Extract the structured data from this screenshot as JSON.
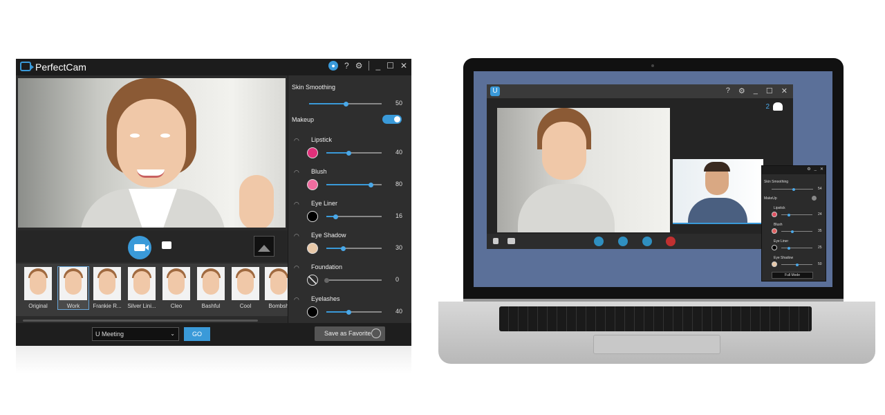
{
  "app": {
    "title": "PerfectCam",
    "titlebar_icons": [
      "bell-icon",
      "help-icon",
      "settings-icon",
      "minimize-icon",
      "maximize-icon",
      "close-icon"
    ],
    "help_label": "?",
    "settings_label": "⚙",
    "minimize_label": "_",
    "maximize_label": "☐",
    "close_label": "✕",
    "presets": [
      {
        "label": "Original"
      },
      {
        "label": "Work",
        "selected": true
      },
      {
        "label": "Frankie R..."
      },
      {
        "label": "Silver Lini..."
      },
      {
        "label": "Cleo"
      },
      {
        "label": "Bashful"
      },
      {
        "label": "Cool"
      },
      {
        "label": "Bombsh"
      }
    ],
    "meeting_select": "U Meeting",
    "go_label": "GO",
    "save_favorite_label": "Save as Favorite",
    "skin_smoothing": {
      "label": "Skin Smoothing",
      "value": 50
    },
    "makeup": {
      "label": "Makeup",
      "enabled": true
    },
    "makeup_items": [
      {
        "label": "Lipstick",
        "value": 40,
        "color": "#e0307a",
        "icon": "lips-icon"
      },
      {
        "label": "Blush",
        "value": 80,
        "color": "#f06da0",
        "icon": "blush-brush-icon"
      },
      {
        "label": "Eye Liner",
        "value": 16,
        "color": "#000000",
        "icon": "eye-icon"
      },
      {
        "label": "Eye Shadow",
        "value": 30,
        "color": "#e8c8a8",
        "icon": "eye-icon"
      },
      {
        "label": "Foundation",
        "value": 0,
        "color": "none",
        "icon": "foundation-icon"
      },
      {
        "label": "Eyelashes",
        "value": 40,
        "color": "#000000",
        "icon": "eyelash-icon"
      }
    ],
    "accent": "#3a9ad9"
  },
  "laptop": {
    "window": {
      "logo": "U",
      "help_label": "?",
      "settings_label": "⚙",
      "minimize_label": "_",
      "maximize_label": "☐",
      "close_label": "✕",
      "participant_count": "2",
      "controls": [
        "microphone-icon",
        "camera-icon",
        "add-participant-icon",
        "share-screen-icon",
        "more-icon",
        "end-call-icon"
      ]
    },
    "mini_panel": {
      "skin_smoothing": {
        "label": "Skin Smoothing",
        "value": 54
      },
      "makeup_label": "MakeUp",
      "items": [
        {
          "label": "Lipstick",
          "value": 24,
          "color": "#e05060"
        },
        {
          "label": "Blush",
          "value": 35,
          "color": "#e06060"
        },
        {
          "label": "Eye Liner",
          "value": 25,
          "color": "#000000"
        },
        {
          "label": "Eye Shadow",
          "value": 50,
          "color": "#e8c8a8"
        }
      ],
      "full_mode_label": "Full Mode"
    }
  }
}
